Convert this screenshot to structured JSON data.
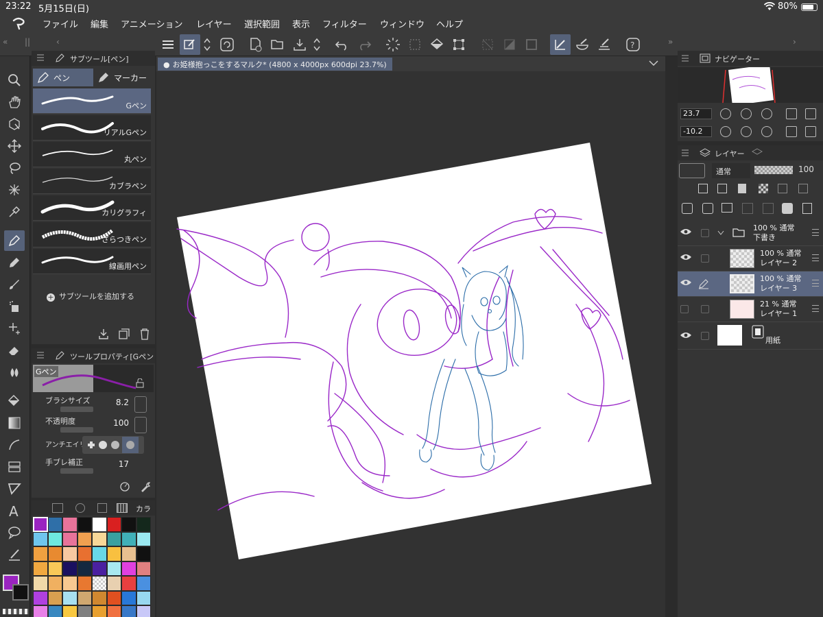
{
  "status": {
    "time": "23:22",
    "date": "5月15日(日)",
    "battery": "80%",
    "battery_level": 0.8
  },
  "menu": [
    "ファイル",
    "編集",
    "アニメーション",
    "レイヤー",
    "選択範囲",
    "表示",
    "フィルター",
    "ウィンドウ",
    "ヘルプ"
  ],
  "document": {
    "title": "お姫様抱っこをするマルク* (4800 x 4000px 600dpi 23.7%)"
  },
  "subtool_panel": {
    "title": "サブツール[ペン]",
    "categories": [
      "ペン",
      "マーカー"
    ],
    "brushes": [
      "Gペン",
      "リアルGペン",
      "丸ペン",
      "カブラペン",
      "カリグラフィ",
      "ざらつきペン",
      "線画用ペン"
    ],
    "add_label": "サブツールを追加する"
  },
  "tool_property": {
    "title": "ツールプロパティ[Gペン",
    "brush_name": "Gペン",
    "brush_size_label": "ブラシサイズ",
    "brush_size": "8.2",
    "opacity_label": "不透明度",
    "opacity": "100",
    "antialias_label": "アンチエイリ",
    "stabilization_label": "手ブレ補正",
    "stabilization": "17"
  },
  "color_panel": {
    "tab_label": "カラ",
    "main_color": "#9a24c0",
    "sub_color": "#111111",
    "palette": [
      "#9a24c0",
      "#2f6fa8",
      "#e8739a",
      "#111111",
      "#ffffff",
      "#d92020",
      "#111111",
      "#14281c",
      "#6fc6ee",
      "#6ee8e0",
      "#e8739a",
      "#f0a050",
      "#f8d898",
      "#3aa0a0",
      "#40b0b8",
      "#9ae8f0",
      "#f0a040",
      "#e88a30",
      "#f8c8a0",
      "#e87030",
      "#68d8e8",
      "#f8c040",
      "#e8c090",
      "#111111",
      "#f0a840",
      "#f8c858",
      "#1a1060",
      "#142840",
      "#4a20a0",
      "#a8e8f0",
      "#e040e0",
      "#e08080",
      "#f0d8a8",
      "#f0b060",
      "#f8c890",
      "#e87830",
      "#transparent",
      "#e8d0b0",
      "#e84040",
      "#4a90e0",
      "#b040e0",
      "#d8a050",
      "#a8e0f0",
      "#d0a870",
      "#d08830",
      "#e05020",
      "#2878d8",
      "#98d8f0",
      "#e880e8",
      "#3888c0",
      "#f8c840",
      "#808080",
      "#e8a030",
      "#f07040",
      "#3878c8",
      "#c8c8f8"
    ]
  },
  "navigator": {
    "title": "ナビゲーター",
    "zoom": "23.7",
    "rotation": "-10.2"
  },
  "layers_panel": {
    "title": "レイヤー",
    "blend_mode": "通常",
    "opacity": "100",
    "layers": [
      {
        "pct": "100 %",
        "mode": "通常",
        "name": "下書き"
      },
      {
        "pct": "100 %",
        "mode": "通常",
        "name": "レイヤー 2"
      },
      {
        "pct": "100 %",
        "mode": "通常",
        "name": "レイヤー 3"
      },
      {
        "pct": "21 %",
        "mode": "通常",
        "name": "レイヤー 1"
      },
      {
        "name": "用紙"
      }
    ]
  },
  "colors": {
    "accent": "#56627a",
    "selected_row": "#5b6782",
    "sketch_purple": "#9a28c8",
    "sketch_blue": "#2a6ca8"
  }
}
